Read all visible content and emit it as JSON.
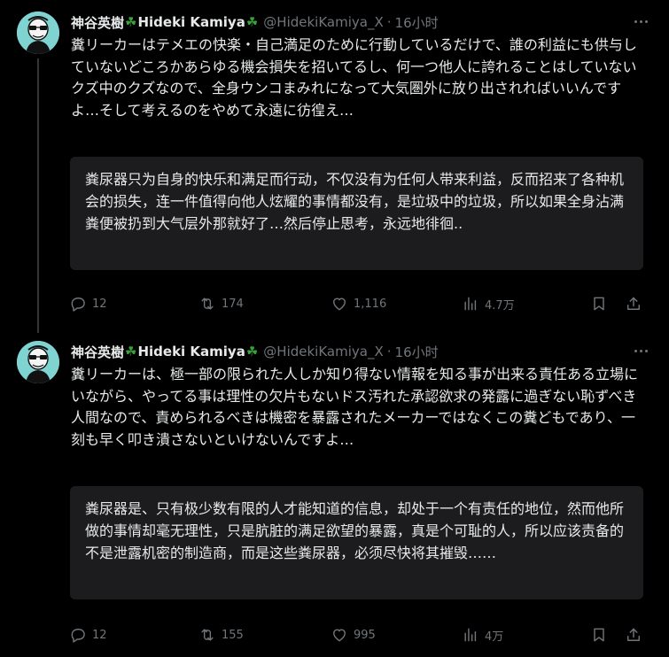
{
  "tweets": [
    {
      "author_name": "神谷英樹",
      "author_name_latin": "Hideki Kamiya",
      "clover_icon": "four-leaf-clover",
      "handle": "@HidekiKamiya_X",
      "separator": "·",
      "time": "16小时",
      "text": "糞リーカーはテメエの快楽・自己満足のために行動しているだけで、誰の利益にも供与していないどころかあらゆる機会損失を招いてるし、何一つ他人に誇れることはしていないクズ中のクズなので、全身ウンコまみれになって大気圏外に放り出されればいいんですよ…そして考えるのをやめて永遠に彷徨え…",
      "translation": "粪尿器只为自身的快乐和满足而行动，不仅没有为任何人带来利益，反而招来了各种机会的损失，连一件值得向他人炫耀的事情都没有，是垃圾中的垃圾，所以如果全身沾满粪便被扔到大气层外那就好了…然后停止思考，永远地徘徊..",
      "replies": "12",
      "retweets": "174",
      "likes": "1,116",
      "views": "4.7万"
    },
    {
      "author_name": "神谷英樹",
      "author_name_latin": "Hideki Kamiya",
      "clover_icon": "four-leaf-clover",
      "handle": "@HidekiKamiya_X",
      "separator": "·",
      "time": "16小时",
      "text": "糞リーカーは、極一部の限られた人しか知り得ない情報を知る事が出来る責任ある立場にいながら、やってる事は理性の欠片もないドス汚れた承認欲求の発露に過ぎない恥ずべき人間なので、責められるべきは機密を暴露されたメーカーではなくこの糞どもであり、一刻も早く叩き潰さないといけないんですよ…",
      "translation": "粪尿器是、只有极少数有限的人才能知道的信息，却处于一个有责任的地位，然而他所做的事情却毫无理性，只是肮脏的满足欲望的暴露，真是个可耻的人，所以应该责备的不是泄露机密的制造商，而是这些粪尿器，必须尽快将其摧毁……",
      "replies": "12",
      "retweets": "155",
      "likes": "995",
      "views": "4万"
    }
  ],
  "colors": {
    "background": "#000000",
    "text": "#e7e9ea",
    "muted": "#71767b",
    "translation_bg": "#1c1c1e",
    "clover": "#3aa13a",
    "avatar_bg": "#7fd3d0"
  }
}
